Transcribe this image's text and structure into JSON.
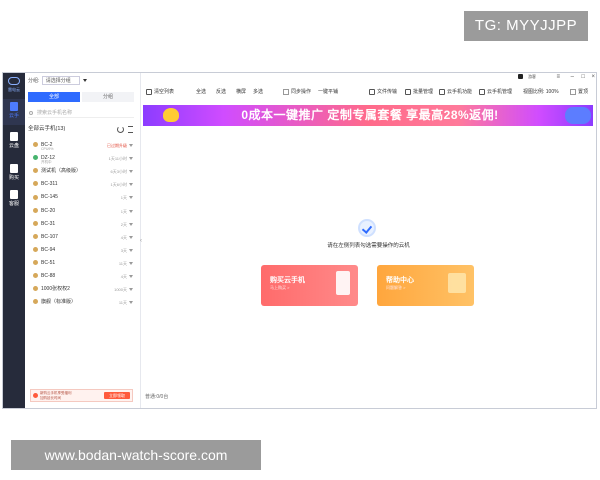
{
  "watermark_top": "TG: MYYJJPP",
  "watermark_bottom": "www.bodan-watch-score.com",
  "rail": {
    "logo_text": "雷电云",
    "items": [
      {
        "label": "云手",
        "icon": "phone-icon"
      },
      {
        "label": "云盘",
        "icon": "cloud-icon"
      },
      {
        "label": "购买",
        "icon": "cart-icon"
      },
      {
        "label": "客服",
        "icon": "user-icon"
      }
    ]
  },
  "left": {
    "group_label": "分组:",
    "group_value": "请选择分组",
    "tab_all": "全部",
    "tab_group": "分组",
    "search_placeholder": "搜索云手机名称",
    "all_devices": "全部云手机(13)",
    "devices": [
      {
        "name": "BC-2",
        "sub": "CPU9%",
        "status": "已过期升级",
        "red": true,
        "green": false
      },
      {
        "name": "DZ-12",
        "sub": "开机中",
        "status": "1天11小时",
        "red": false,
        "green": true
      },
      {
        "name": "测试机（高级版）",
        "sub": "",
        "status": "6天3小时",
        "red": false,
        "green": false
      },
      {
        "name": "BC-311",
        "sub": "",
        "status": "1天6小时",
        "red": false,
        "green": false
      },
      {
        "name": "BC-145",
        "sub": "",
        "status": "1天",
        "red": false,
        "green": false
      },
      {
        "name": "BC-20",
        "sub": "",
        "status": "1天",
        "red": false,
        "green": false
      },
      {
        "name": "BC-31",
        "sub": "",
        "status": "2天",
        "red": false,
        "green": false
      },
      {
        "name": "BC-107",
        "sub": "",
        "status": "4天",
        "red": false,
        "green": false
      },
      {
        "name": "BC-94",
        "sub": "",
        "status": "3天",
        "red": false,
        "green": false
      },
      {
        "name": "BC-51",
        "sub": "",
        "status": "11天",
        "red": false,
        "green": false
      },
      {
        "name": "BC-88",
        "sub": "",
        "status": "4天",
        "red": false,
        "green": false
      },
      {
        "name": "1000张权权2",
        "sub": "",
        "status": "1000天",
        "red": false,
        "green": false
      },
      {
        "name": "旗舰（标准版）",
        "sub": "",
        "status": "11天",
        "red": false,
        "green": false
      }
    ],
    "ad_line1": "新购云手机享受福利",
    "ad_line2": "加购延长时间",
    "ad_button": "立即领取"
  },
  "toolbar": {
    "username": "游客",
    "items": [
      "清空列表",
      "全选",
      "反选",
      "横屏",
      "多选",
      "同步操作",
      "一键平铺",
      "文件传输",
      "批量管理",
      "云手机功能",
      "云手机管理",
      "视图比例: 100%",
      "置顶"
    ]
  },
  "promo_text": "0成本一键推广  定制专属套餐  享最高28%返佣!",
  "empty_text": "请在左侧列表勾选需要操作的云机",
  "cards": {
    "buy_title": "购买云手机",
    "buy_sub": "马上购买 >",
    "help_title": "帮助中心",
    "help_sub": "问题解答 >"
  },
  "status_text": "普通:0/0台"
}
